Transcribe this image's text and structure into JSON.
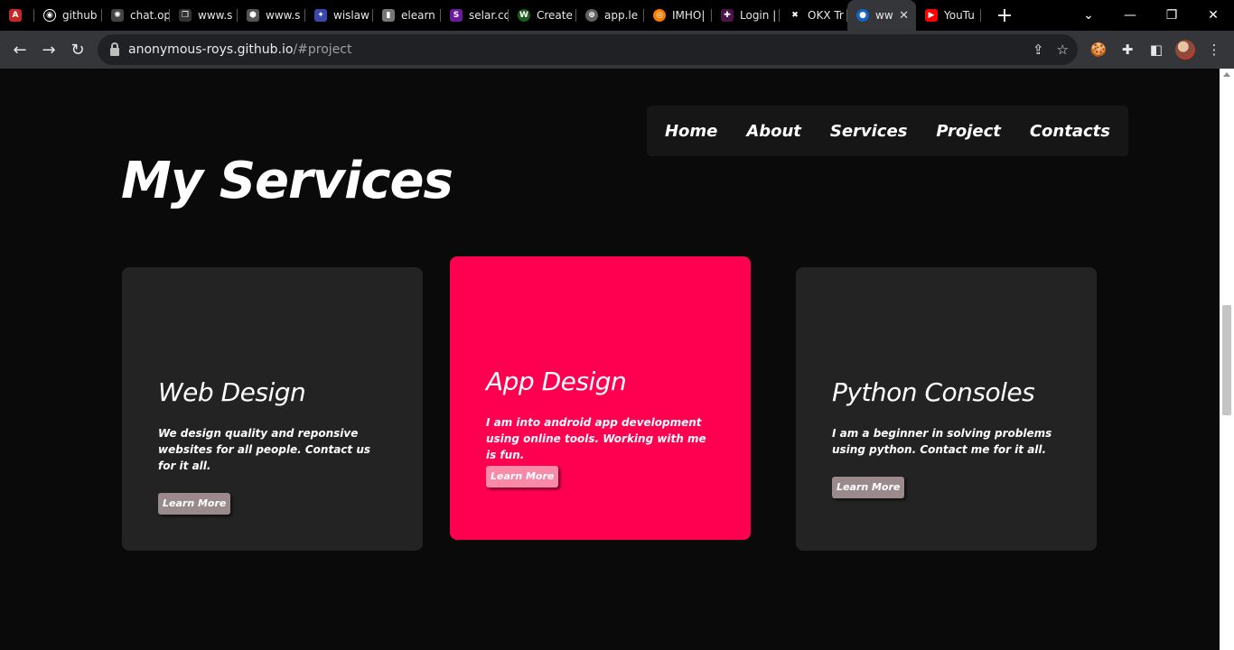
{
  "browser": {
    "tabs": [
      {
        "label": "",
        "favicon_color": "#c62828",
        "favicon_glyph": "A"
      },
      {
        "label": "github",
        "favicon_color": "#000000",
        "favicon_glyph": "◉"
      },
      {
        "label": "chat.op",
        "favicon_color": "#444444",
        "favicon_glyph": "✺"
      },
      {
        "label": "www.s",
        "favicon_color": "#333333",
        "favicon_glyph": "❐"
      },
      {
        "label": "www.s",
        "favicon_color": "#555555",
        "favicon_glyph": "⬢"
      },
      {
        "label": "wislaw",
        "favicon_color": "#3949ab",
        "favicon_glyph": "✦"
      },
      {
        "label": "elearn",
        "favicon_color": "#777777",
        "favicon_glyph": "▮"
      },
      {
        "label": "selar.co",
        "favicon_color": "#6a1b9a",
        "favicon_glyph": "S"
      },
      {
        "label": "Create",
        "favicon_color": "#1b5e20",
        "favicon_glyph": "W"
      },
      {
        "label": "app.le",
        "favicon_color": "#616161",
        "favicon_glyph": "⊛"
      },
      {
        "label": "IMHO|",
        "favicon_color": "#f57c00",
        "favicon_glyph": "◎"
      },
      {
        "label": "Login |",
        "favicon_color": "#4a154b",
        "favicon_glyph": "✚"
      },
      {
        "label": "OKX Tr",
        "favicon_color": "#000000",
        "favicon_glyph": "✖"
      },
      {
        "label": "ww",
        "favicon_color": "#1565c0",
        "favicon_glyph": "●",
        "active": true
      },
      {
        "label": "YouTu",
        "favicon_color": "#ff0000",
        "favicon_glyph": "▶"
      }
    ],
    "url_host": "anonymous-roys.github.io",
    "url_path": "/#project"
  },
  "nav": {
    "home": "Home",
    "about": "About",
    "services": "Services",
    "project": "Project",
    "contacts": "Contacts"
  },
  "section": {
    "title": "My Services"
  },
  "cards": [
    {
      "title": "Web Design",
      "text": "We design quality and reponsive websites for all people. Contact us for it all.",
      "button": "Learn More"
    },
    {
      "title": "App Design",
      "text": "I am into android app development using online tools. Working with me is fun.",
      "button": "Learn More"
    },
    {
      "title": "Python Consoles",
      "text": "I am a beginner in solving problems using python. Contact me for it all.",
      "button": "Learn More"
    }
  ],
  "colors": {
    "background": "#0a0a0a",
    "card": "#232323",
    "accent": "#ff0050"
  }
}
